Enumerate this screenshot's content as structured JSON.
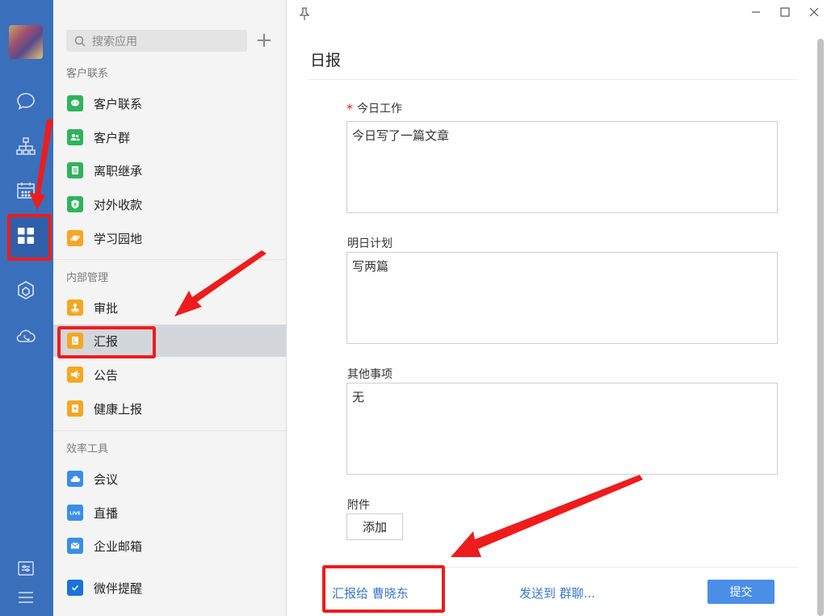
{
  "sidebar_rail": {
    "icons": [
      "chat-bubble-icon",
      "org-chart-icon",
      "calendar-icon",
      "apps-grid-icon",
      "workbench-cube-icon",
      "cloud-phone-icon",
      "settings-sliders-icon",
      "menu-hamburger-icon"
    ]
  },
  "app_menu": {
    "search_placeholder": "搜索应用",
    "add_label": "+",
    "sections": [
      {
        "title": "客户联系",
        "items": [
          {
            "label": "客户联系",
            "icon": "wechat-chat-icon",
            "color": "#2fb35c"
          },
          {
            "label": "客户群",
            "icon": "customer-group-icon",
            "color": "#2fb35c"
          },
          {
            "label": "离职继承",
            "icon": "document-icon",
            "color": "#2fb35c"
          },
          {
            "label": "对外收款",
            "icon": "shield-yen-icon",
            "color": "#2fb35c"
          },
          {
            "label": "学习园地",
            "icon": "planet-icon",
            "color": "#f5a623"
          }
        ]
      },
      {
        "title": "内部管理",
        "items": [
          {
            "label": "审批",
            "icon": "stamp-icon",
            "color": "#f5a623"
          },
          {
            "label": "汇报",
            "icon": "report-icon",
            "color": "#f5a623",
            "selected": true
          },
          {
            "label": "公告",
            "icon": "megaphone-icon",
            "color": "#f5a623"
          },
          {
            "label": "健康上报",
            "icon": "health-report-icon",
            "color": "#f5a623"
          }
        ]
      },
      {
        "title": "效率工具",
        "items": [
          {
            "label": "会议",
            "icon": "cloud-meeting-icon",
            "color": "#3a8ee6"
          },
          {
            "label": "直播",
            "icon": "live-icon",
            "color": "#3a8ee6",
            "icon_text": "LIVE"
          },
          {
            "label": "企业邮箱",
            "icon": "mail-icon",
            "color": "#3a8ee6"
          },
          {
            "label": "微伴提醒",
            "icon": "checkbox-icon",
            "color": "#1a73d9"
          }
        ]
      }
    ]
  },
  "report_form": {
    "title": "日报",
    "required_mark": "*",
    "fields": [
      {
        "label": "今日工作",
        "value": "今日写了一篇文章",
        "required": true
      },
      {
        "label": "明日计划",
        "value": "写两篇",
        "required": false
      },
      {
        "label": "其他事项",
        "value": "无",
        "required": false
      }
    ],
    "attachment_label": "附件",
    "add_button": "添加",
    "report_to": "汇报给 曹晓东",
    "send_to_group": "发送到 群聊...",
    "submit_button": "提交"
  },
  "colors": {
    "rail_bg": "#3a6fbc",
    "accent_blue": "#3a78c9",
    "submit_bg": "#4a8ee6",
    "annotation_red": "#ee1c1c"
  }
}
